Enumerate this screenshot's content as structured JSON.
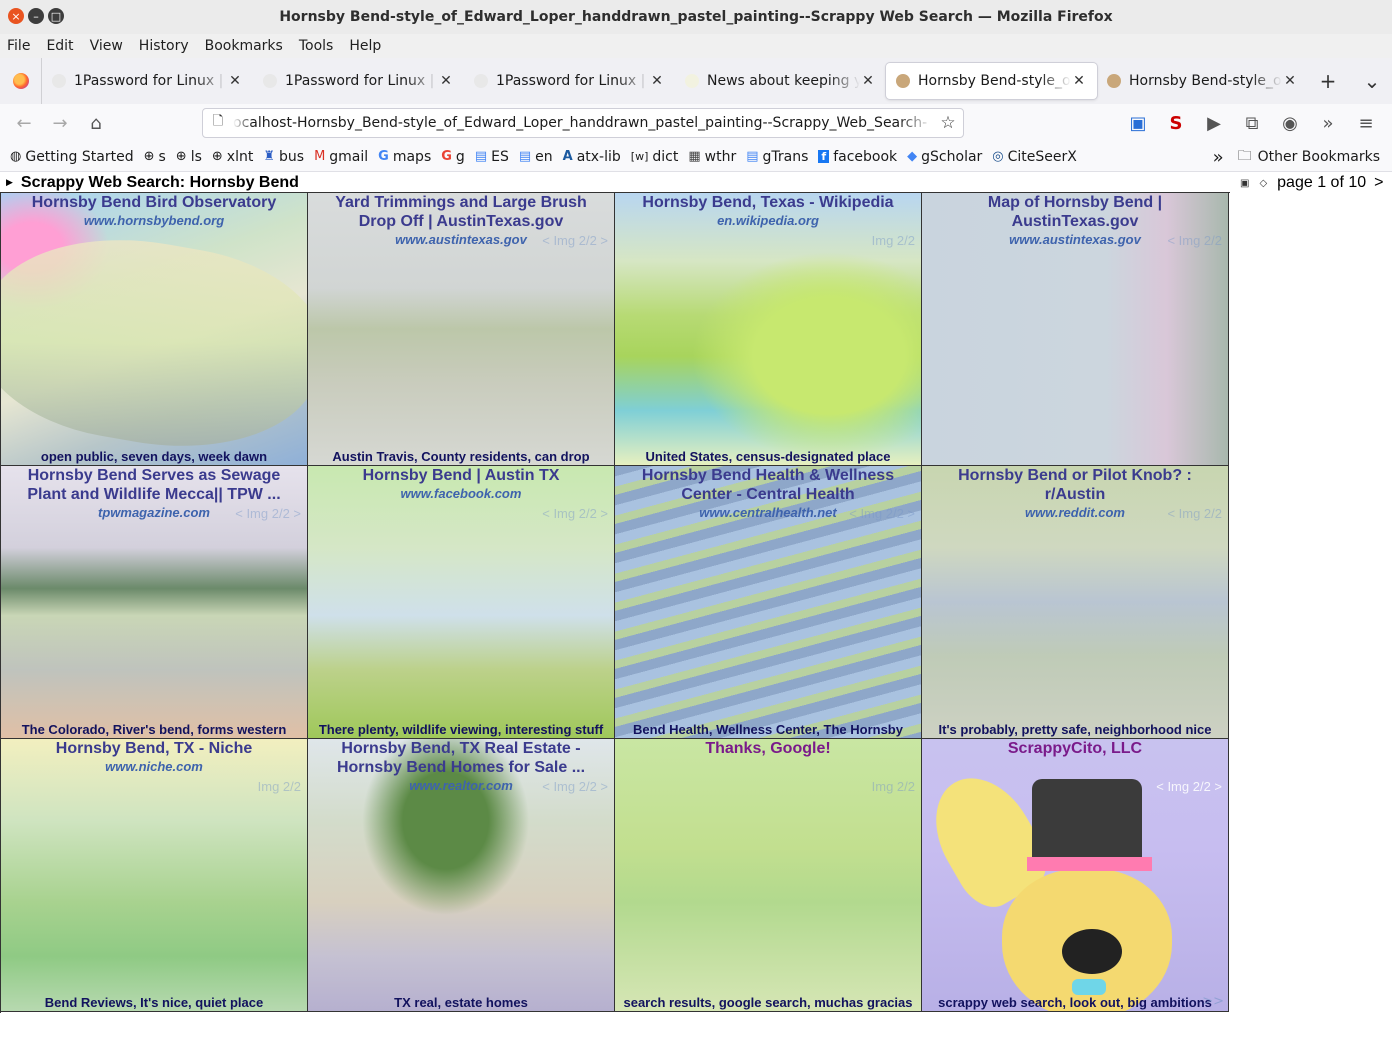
{
  "window": {
    "title": "Hornsby Bend-style_of_Edward_Loper_handdrawn_pastel_painting--Scrappy Web Search — Mozilla Firefox"
  },
  "menubar": [
    "File",
    "Edit",
    "View",
    "History",
    "Bookmarks",
    "Tools",
    "Help"
  ],
  "tabs": [
    {
      "label": "1Password for Linux | 1",
      "active": false
    },
    {
      "label": "1Password for Linux | 1",
      "active": false
    },
    {
      "label": "1Password for Linux | 1",
      "active": false
    },
    {
      "label": "News about keeping yo",
      "active": false
    },
    {
      "label": "Hornsby Bend-style_of",
      "active": true
    },
    {
      "label": "Hornsby Bend-style_of",
      "active": false
    }
  ],
  "urlbar": {
    "value": "ocalhost-Hornsby_Bend-style_of_Edward_Loper_handdrawn_pastel_painting--Scrappy_Web_Search-"
  },
  "bookmarks": [
    {
      "label": "Getting Started",
      "icon": "firefox-icon"
    },
    {
      "label": "s",
      "icon": "globe-icon"
    },
    {
      "label": "ls",
      "icon": "globe-icon"
    },
    {
      "label": "xlnt",
      "icon": "globe-icon"
    },
    {
      "label": "bus",
      "icon": "bus-icon"
    },
    {
      "label": "gmail",
      "icon": "gmail-icon"
    },
    {
      "label": "maps",
      "icon": "google-icon"
    },
    {
      "label": "g",
      "icon": "google-icon"
    },
    {
      "label": "ES",
      "icon": "translate-icon"
    },
    {
      "label": "en",
      "icon": "translate-icon"
    },
    {
      "label": "atx-lib",
      "icon": "library-icon"
    },
    {
      "label": "dict",
      "icon": "dict-icon"
    },
    {
      "label": "wthr",
      "icon": "weather-icon"
    },
    {
      "label": "gTrans",
      "icon": "translate-icon"
    },
    {
      "label": "facebook",
      "icon": "facebook-icon"
    },
    {
      "label": "gScholar",
      "icon": "scholar-icon"
    },
    {
      "label": "CiteSeerX",
      "icon": "citeseer-icon"
    }
  ],
  "other_bookmarks": "Other Bookmarks",
  "page": {
    "heading": "Scrappy Web Search: Hornsby Bend",
    "pager": "page 1 of 10",
    "next": ">"
  },
  "results": [
    {
      "title": "Hornsby Bend Bird Observatory",
      "site": "www.hornsbybend.org",
      "img": "",
      "footer": "open public, seven days, week dawn"
    },
    {
      "title": "Yard Trimmings and Large Brush Drop Off | AustinTexas.gov",
      "site": "www.austintexas.gov",
      "img": "< Img 2/2 >",
      "footer": "Austin Travis, County residents, can drop"
    },
    {
      "title": "Hornsby Bend, Texas - Wikipedia",
      "site": "en.wikipedia.org",
      "img": "Img 2/2",
      "footer": "United States, census-designated place"
    },
    {
      "title": "Map of Hornsby Bend | AustinTexas.gov",
      "site": "www.austintexas.gov",
      "img": "< Img 2/2",
      "footer": ""
    },
    {
      "title": "Hornsby Bend Serves as Sewage Plant and Wildlife Mecca|| TPW ...",
      "site": "tpwmagazine.com",
      "img": "< Img 2/2 >",
      "footer": "The Colorado, River's bend, forms western"
    },
    {
      "title": "Hornsby Bend | Austin TX",
      "site": "www.facebook.com",
      "img": "< Img 2/2 >",
      "footer": "There plenty, wildlife viewing, interesting stuff"
    },
    {
      "title": "Hornsby Bend Health & Wellness Center - Central Health",
      "site": "www.centralhealth.net",
      "img": "< Img 2/2 >",
      "footer": "Bend Health, Wellness Center, The Hornsby"
    },
    {
      "title": "Hornsby Bend or Pilot Knob? : r/Austin",
      "site": "www.reddit.com",
      "img": "< Img 2/2",
      "footer": "It's probably, pretty safe, neighborhood nice"
    },
    {
      "title": "Hornsby Bend, TX - Niche",
      "site": "www.niche.com",
      "img": "Img 2/2",
      "footer": "Bend Reviews, It's nice, quiet place"
    },
    {
      "title": "Hornsby Bend, TX Real Estate - Hornsby Bend Homes for Sale ...",
      "site": "www.realtor.com",
      "img": "< Img 2/2 >",
      "footer": "TX real, estate homes"
    },
    {
      "title": "Thanks, Google!",
      "site": "",
      "img": "Img 2/2",
      "footer": "search results, google search, muchas gracias"
    },
    {
      "title": "ScrappyCito, LLC",
      "site": "",
      "img": "< Img 2/2 >",
      "footer": "scrappy web search, look out, big ambitions",
      "more": ">>"
    }
  ],
  "colors": {
    "title_link": "#3b3b8e",
    "site_link": "#3e63ad",
    "footer_text": "#12125e",
    "visited_title": "#7a1a8a"
  }
}
